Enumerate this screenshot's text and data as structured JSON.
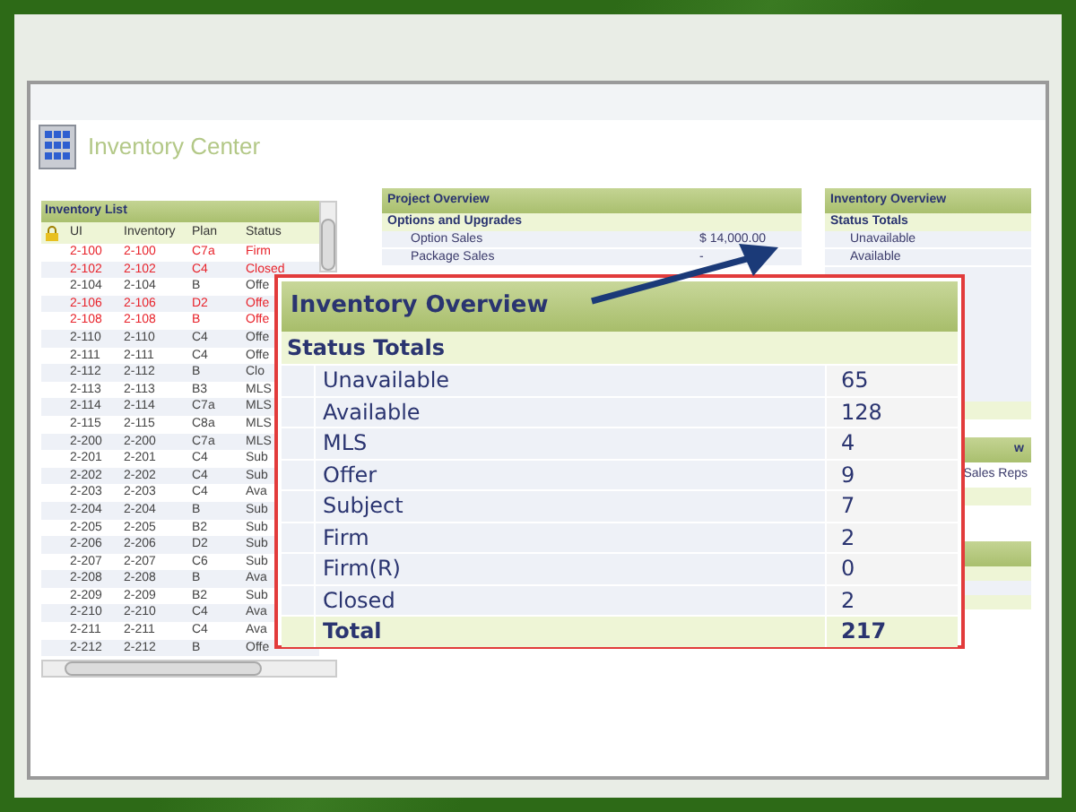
{
  "window": {
    "title": "Inventory Center"
  },
  "inventory_list": {
    "title": "Inventory List",
    "columns": [
      "UI",
      "Inventory",
      "Plan",
      "Status"
    ],
    "rows": [
      {
        "ui": "2-100",
        "inventory": "2-100",
        "plan": "C7a",
        "status": "Firm",
        "highlighted": true
      },
      {
        "ui": "2-102",
        "inventory": "2-102",
        "plan": "C4",
        "status": "Closed",
        "highlighted": true
      },
      {
        "ui": "2-104",
        "inventory": "2-104",
        "plan": "B",
        "status": "Offe",
        "highlighted": false
      },
      {
        "ui": "2-106",
        "inventory": "2-106",
        "plan": "D2",
        "status": "Offe",
        "highlighted": true
      },
      {
        "ui": "2-108",
        "inventory": "2-108",
        "plan": "B",
        "status": "Offe",
        "highlighted": true
      },
      {
        "ui": "2-110",
        "inventory": "2-110",
        "plan": "C4",
        "status": "Offe",
        "highlighted": false
      },
      {
        "ui": "2-111",
        "inventory": "2-111",
        "plan": "C4",
        "status": "Offe",
        "highlighted": false
      },
      {
        "ui": "2-112",
        "inventory": "2-112",
        "plan": "B",
        "status": "Clo",
        "highlighted": false
      },
      {
        "ui": "2-113",
        "inventory": "2-113",
        "plan": "B3",
        "status": "MLS",
        "highlighted": false
      },
      {
        "ui": "2-114",
        "inventory": "2-114",
        "plan": "C7a",
        "status": "MLS",
        "highlighted": false
      },
      {
        "ui": "2-115",
        "inventory": "2-115",
        "plan": "C8a",
        "status": "MLS",
        "highlighted": false
      },
      {
        "ui": "2-200",
        "inventory": "2-200",
        "plan": "C7a",
        "status": "MLS",
        "highlighted": false
      },
      {
        "ui": "2-201",
        "inventory": "2-201",
        "plan": "C4",
        "status": "Sub",
        "highlighted": false
      },
      {
        "ui": "2-202",
        "inventory": "2-202",
        "plan": "C4",
        "status": "Sub",
        "highlighted": false
      },
      {
        "ui": "2-203",
        "inventory": "2-203",
        "plan": "C4",
        "status": "Ava",
        "highlighted": false
      },
      {
        "ui": "2-204",
        "inventory": "2-204",
        "plan": "B",
        "status": "Sub",
        "highlighted": false
      },
      {
        "ui": "2-205",
        "inventory": "2-205",
        "plan": "B2",
        "status": "Sub",
        "highlighted": false
      },
      {
        "ui": "2-206",
        "inventory": "2-206",
        "plan": "D2",
        "status": "Sub",
        "highlighted": false
      },
      {
        "ui": "2-207",
        "inventory": "2-207",
        "plan": "C6",
        "status": "Sub",
        "highlighted": false
      },
      {
        "ui": "2-208",
        "inventory": "2-208",
        "plan": "B",
        "status": "Ava",
        "highlighted": false
      },
      {
        "ui": "2-209",
        "inventory": "2-209",
        "plan": "B2",
        "status": "Sub",
        "highlighted": false
      },
      {
        "ui": "2-210",
        "inventory": "2-210",
        "plan": "C4",
        "status": "Ava",
        "highlighted": false
      },
      {
        "ui": "2-211",
        "inventory": "2-211",
        "plan": "C4",
        "status": "Ava",
        "highlighted": false
      },
      {
        "ui": "2-212",
        "inventory": "2-212",
        "plan": "B",
        "status": "Offe",
        "highlighted": false
      }
    ]
  },
  "project_overview": {
    "title": "Project Overview",
    "section": "Options and Upgrades",
    "rows": [
      {
        "label": "Option Sales",
        "value": "$ 14,000.00"
      },
      {
        "label": "Package Sales",
        "value": "-"
      }
    ]
  },
  "inventory_overview_small": {
    "title": "Inventory Overview",
    "section": "Status Totals",
    "rows": [
      "Unavailable",
      "Available"
    ]
  },
  "side_panel": {
    "title": "w",
    "rows": [
      "Sales Reps"
    ]
  },
  "callout": {
    "title": "Inventory Overview",
    "section": "Status Totals",
    "rows": [
      {
        "label": "Unavailable",
        "value": "65",
        "kind": "item"
      },
      {
        "label": "Available",
        "value": "128",
        "kind": "item"
      },
      {
        "label": "MLS",
        "value": "4",
        "kind": "item"
      },
      {
        "label": "Offer",
        "value": "9",
        "kind": "item"
      },
      {
        "label": "Subject",
        "value": "7",
        "kind": "item"
      },
      {
        "label": "Firm",
        "value": "2",
        "kind": "item"
      },
      {
        "label": "Firm(R)",
        "value": "0",
        "kind": "item"
      },
      {
        "label": "Closed",
        "value": "2",
        "kind": "item"
      },
      {
        "label": "Total",
        "value": "217",
        "kind": "total"
      }
    ]
  }
}
